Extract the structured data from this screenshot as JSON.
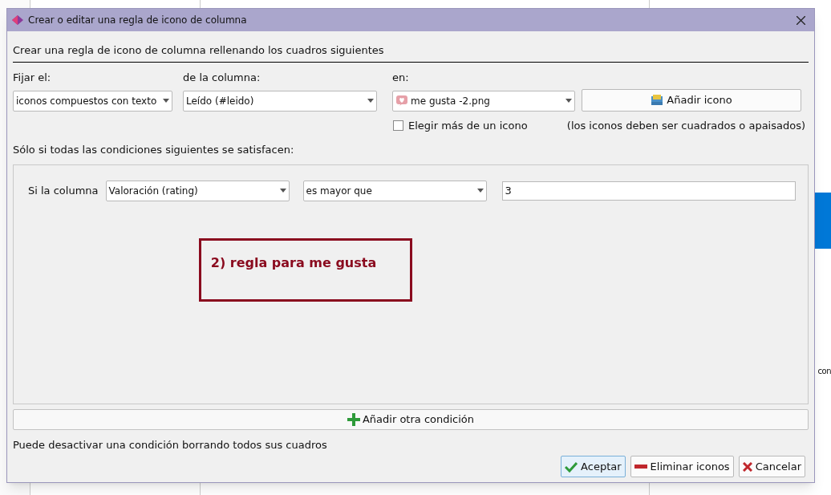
{
  "background": {
    "cell_fragment": "con"
  },
  "dialog": {
    "title": "Crear o editar una regla de icono de columna",
    "intro": "Crear una regla de icono de columna rellenando los cuadros siguientes",
    "fields": [
      {
        "label": "Fijar el:",
        "value": "iconos compuestos con texto"
      },
      {
        "label": "de la columna:",
        "value": "Leído (#leido)"
      },
      {
        "label": "en:",
        "value": "me gusta -2.png"
      }
    ],
    "add_icon_button": "Añadir icono",
    "multiple_icons": {
      "label": "Elegir más de un icono",
      "checked": false
    },
    "icon_hint": "(los iconos deben ser cuadrados o apaisados)",
    "conditions_label": "Sólo si todas las condiciones siguientes se satisfacen:",
    "conditions": [
      {
        "prefix": "Si la columna",
        "column": "Valoración (rating)",
        "operator": "es mayor que",
        "value": "3"
      }
    ],
    "annotation": "2) regla para me gusta",
    "add_condition_button": "Añadir otra condición",
    "footer_note": "Puede desactivar una condición borrando todos sus cuadros",
    "buttons": [
      {
        "label": "Aceptar",
        "kind": "accept"
      },
      {
        "label": "Eliminar iconos",
        "kind": "remove"
      },
      {
        "label": "Cancelar",
        "kind": "cancel"
      }
    ]
  }
}
